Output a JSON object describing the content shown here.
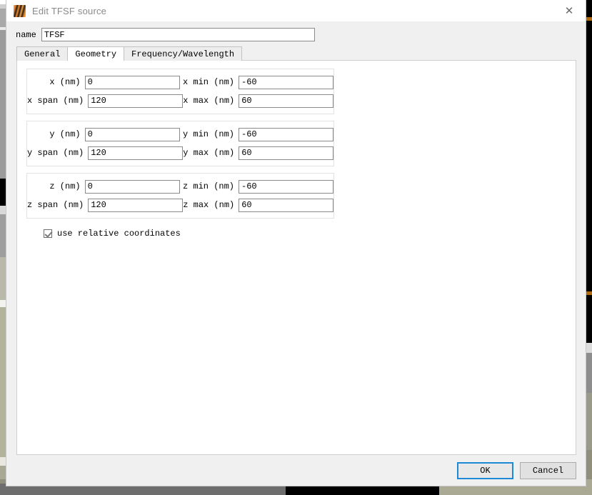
{
  "window": {
    "title": "Edit TFSF source",
    "icon": "lumerical-app-icon",
    "close_label": "✕"
  },
  "name_field": {
    "label": "name",
    "value": "TFSF",
    "placeholder": ""
  },
  "tabs": [
    {
      "label": "General",
      "active": false
    },
    {
      "label": "Geometry",
      "active": true
    },
    {
      "label": "Frequency/Wavelength",
      "active": false
    }
  ],
  "geometry": {
    "groups": [
      {
        "axis": "x",
        "rows": [
          {
            "left_label": "x (nm)",
            "left_value": "0",
            "right_label": "x min (nm)",
            "right_value": "-60"
          },
          {
            "left_label": "x span (nm)",
            "left_value": "120",
            "right_label": "x max (nm)",
            "right_value": "60"
          }
        ]
      },
      {
        "axis": "y",
        "rows": [
          {
            "left_label": "y (nm)",
            "left_value": "0",
            "right_label": "y min (nm)",
            "right_value": "-60"
          },
          {
            "left_label": "y span (nm)",
            "left_value": "120",
            "right_label": "y max (nm)",
            "right_value": "60"
          }
        ]
      },
      {
        "axis": "z",
        "rows": [
          {
            "left_label": "z (nm)",
            "left_value": "0",
            "right_label": "z min (nm)",
            "right_value": "-60"
          },
          {
            "left_label": "z span (nm)",
            "left_value": "120",
            "right_label": "z max (nm)",
            "right_value": "60"
          }
        ]
      }
    ],
    "relative_coordinates": {
      "label": "use relative coordinates",
      "checked": true
    }
  },
  "footer": {
    "ok_label": "OK",
    "cancel_label": "Cancel"
  },
  "colors": {
    "focus_blue": "#1e8ad6",
    "dialog_bg": "#f0f0f0",
    "panel_bg": "#ffffff",
    "title_text": "#8a8a8a",
    "accent_orange": "#b06a10"
  }
}
